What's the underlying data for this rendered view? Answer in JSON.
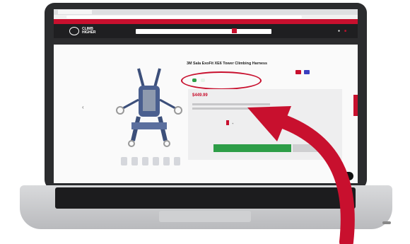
{
  "browser": {
    "tab_title": "",
    "url": ""
  },
  "site": {
    "promo_items": [
      "",
      "",
      "",
      "",
      "",
      ""
    ],
    "logo_text_line1": "CLIMB",
    "logo_text_line2": "HIGHER",
    "search_placeholder": "",
    "nav_items": [
      "",
      "",
      "",
      "",
      "",
      "",
      "",
      "",
      ""
    ],
    "breadcrumb_home": "",
    "breadcrumb_current": ""
  },
  "product": {
    "title": "3M Sala ExoFit XE6 Tower Climbing Harness",
    "subtitle": "",
    "stock_primary": "",
    "stock_secondary": "",
    "price": "$449.99",
    "qty_label": "",
    "option_label": "",
    "add_to_cart": ""
  },
  "widgets": {
    "chat_label": ""
  },
  "colors": {
    "brand_red": "#c8102e",
    "stock_green": "#2d9d47",
    "header_dark": "#1f1f21"
  }
}
